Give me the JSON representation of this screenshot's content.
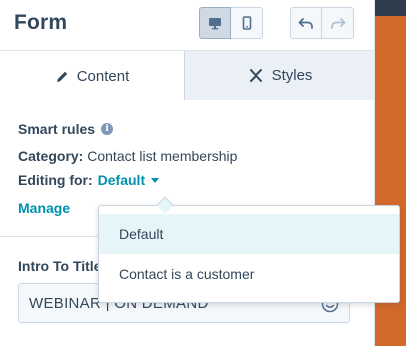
{
  "header": {
    "title": "Form",
    "view_toggle": {
      "desktop_icon": "desktop-icon",
      "mobile_icon": "mobile-icon",
      "active": "desktop"
    },
    "history": {
      "undo_icon": "undo-icon",
      "redo_icon": "redo-icon"
    }
  },
  "tabs": [
    {
      "label": "Content",
      "icon": "pencil-icon",
      "active": true
    },
    {
      "label": "Styles",
      "icon": "brush-icon",
      "active": false
    }
  ],
  "smart_rules": {
    "heading": "Smart rules",
    "category_label": "Category:",
    "category_value": "Contact list membership",
    "editing_label": "Editing for:",
    "editing_value": "Default",
    "manage_link": "Manage"
  },
  "field": {
    "label": "Intro To Title",
    "value": "WEBINAR | ON DEMAND"
  },
  "dropdown": {
    "options": [
      "Default",
      "Contact is a customer"
    ],
    "highlighted": "Default"
  },
  "colors": {
    "accent": "#0091ae",
    "text": "#33475b",
    "tab_bg": "#eaf0f6",
    "side_orange": "#d2692a"
  }
}
